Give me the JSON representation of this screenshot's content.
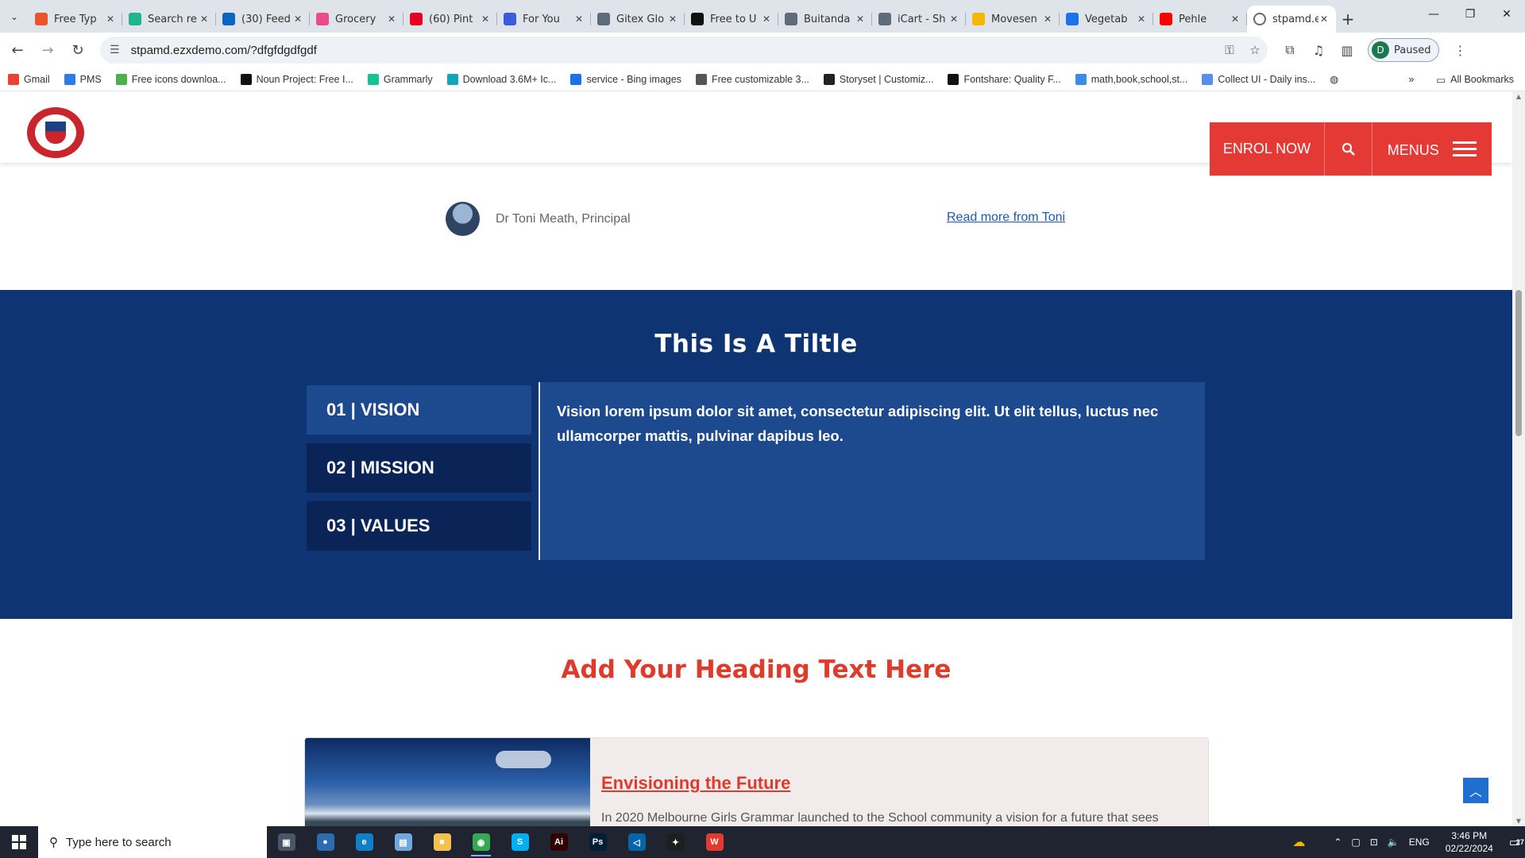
{
  "browser": {
    "tabs": [
      {
        "title": "Free Typ",
        "color": "#e8552f"
      },
      {
        "title": "Search re",
        "color": "#22b38f"
      },
      {
        "title": "(30) Feed",
        "color": "#0a66c2"
      },
      {
        "title": "Grocery",
        "color": "#ea4c89"
      },
      {
        "title": "(60) Pint",
        "color": "#e60023"
      },
      {
        "title": "For You",
        "color": "#3b5bdb"
      },
      {
        "title": "Gitex Glo",
        "color": "#5f6b7a"
      },
      {
        "title": "Free to U",
        "color": "#111111"
      },
      {
        "title": "Buitanda",
        "color": "#5f6b7a"
      },
      {
        "title": "iCart - Sh",
        "color": "#5f6b7a"
      },
      {
        "title": "Movesen",
        "color": "#f5b700"
      },
      {
        "title": "Vegetab",
        "color": "#1a73e8"
      },
      {
        "title": "Pehle",
        "color": "#ff0000"
      }
    ],
    "active_tab": {
      "title": "stpamd.e",
      "color": "#5f6b7a"
    },
    "url": "stpamd.ezxdemo.com/?dfgfdgdfgdf",
    "profile_initial": "D",
    "profile_status": "Paused",
    "bookmarks": [
      {
        "label": "Gmail",
        "color": "#ea4335"
      },
      {
        "label": "PMS",
        "color": "#2b7de9"
      },
      {
        "label": "Free icons downloa...",
        "color": "#4caf50"
      },
      {
        "label": "Noun Project: Free I...",
        "color": "#111111"
      },
      {
        "label": "Grammarly",
        "color": "#15c39a"
      },
      {
        "label": "Download 3.6M+ Ic...",
        "color": "#12a7b8"
      },
      {
        "label": "service - Bing images",
        "color": "#1a73e8"
      },
      {
        "label": "Free customizable 3...",
        "color": "#555555"
      },
      {
        "label": "Storyset | Customiz...",
        "color": "#222222"
      },
      {
        "label": "Fontshare: Quality F...",
        "color": "#111111"
      },
      {
        "label": "math,book,school,st...",
        "color": "#3a8de0"
      },
      {
        "label": "Collect UI - Daily ins...",
        "color": "#5b8def"
      }
    ],
    "all_bookmarks": "All Bookmarks"
  },
  "header": {
    "enrol_label": "ENROL NOW",
    "menus_label": "MENUS"
  },
  "principal": {
    "name": "Dr Toni Meath, Principal",
    "read_more": "Read more from Toni"
  },
  "blue_section": {
    "title": "This Is A Tiltle",
    "tabs": [
      {
        "label": "01 | VISION"
      },
      {
        "label": "02 | MISSION"
      },
      {
        "label": "03 | VALUES"
      }
    ],
    "active_tab_index": 0,
    "panel_text": "Vision lorem ipsum dolor sit amet, consectetur adipiscing elit. Ut elit tellus, luctus nec ullamcorper mattis, pulvinar dapibus leo."
  },
  "red_heading": "Add Your Heading Text Here",
  "card": {
    "title": "Envisioning the Future",
    "text": "In 2020 Melbourne Girls Grammar launched to the School community a vision for a future that sees"
  },
  "colors": {
    "brand_red": "#e53935",
    "navy": "#0f3473",
    "panel_blue": "#1d4a8f",
    "heading_red": "#df3b2d"
  },
  "taskbar": {
    "search_placeholder": "Type here to search",
    "language": "ENG",
    "time": "3:46 PM",
    "date": "02/22/2024",
    "notifications": "27",
    "apps": [
      {
        "name": "task-view",
        "color": "#4a5568",
        "glyph": "▣"
      },
      {
        "name": "cortana",
        "color": "#2b6cb0",
        "glyph": "●"
      },
      {
        "name": "edge",
        "color": "#0f7fc7",
        "glyph": "e"
      },
      {
        "name": "notepad",
        "color": "#6fa8dc",
        "glyph": "▤"
      },
      {
        "name": "file-explorer",
        "color": "#f2c14e",
        "glyph": "■"
      },
      {
        "name": "chrome",
        "color": "#34a853",
        "glyph": "◉"
      },
      {
        "name": "skype",
        "color": "#00aff0",
        "glyph": "S"
      },
      {
        "name": "illustrator",
        "color": "#330000",
        "glyph": "Ai"
      },
      {
        "name": "photoshop",
        "color": "#001e36",
        "glyph": "Ps"
      },
      {
        "name": "vscode",
        "color": "#0065a9",
        "glyph": "◁"
      },
      {
        "name": "figma",
        "color": "#1e1e1e",
        "glyph": "✦"
      },
      {
        "name": "wps",
        "color": "#e23b2e",
        "glyph": "W"
      }
    ]
  }
}
